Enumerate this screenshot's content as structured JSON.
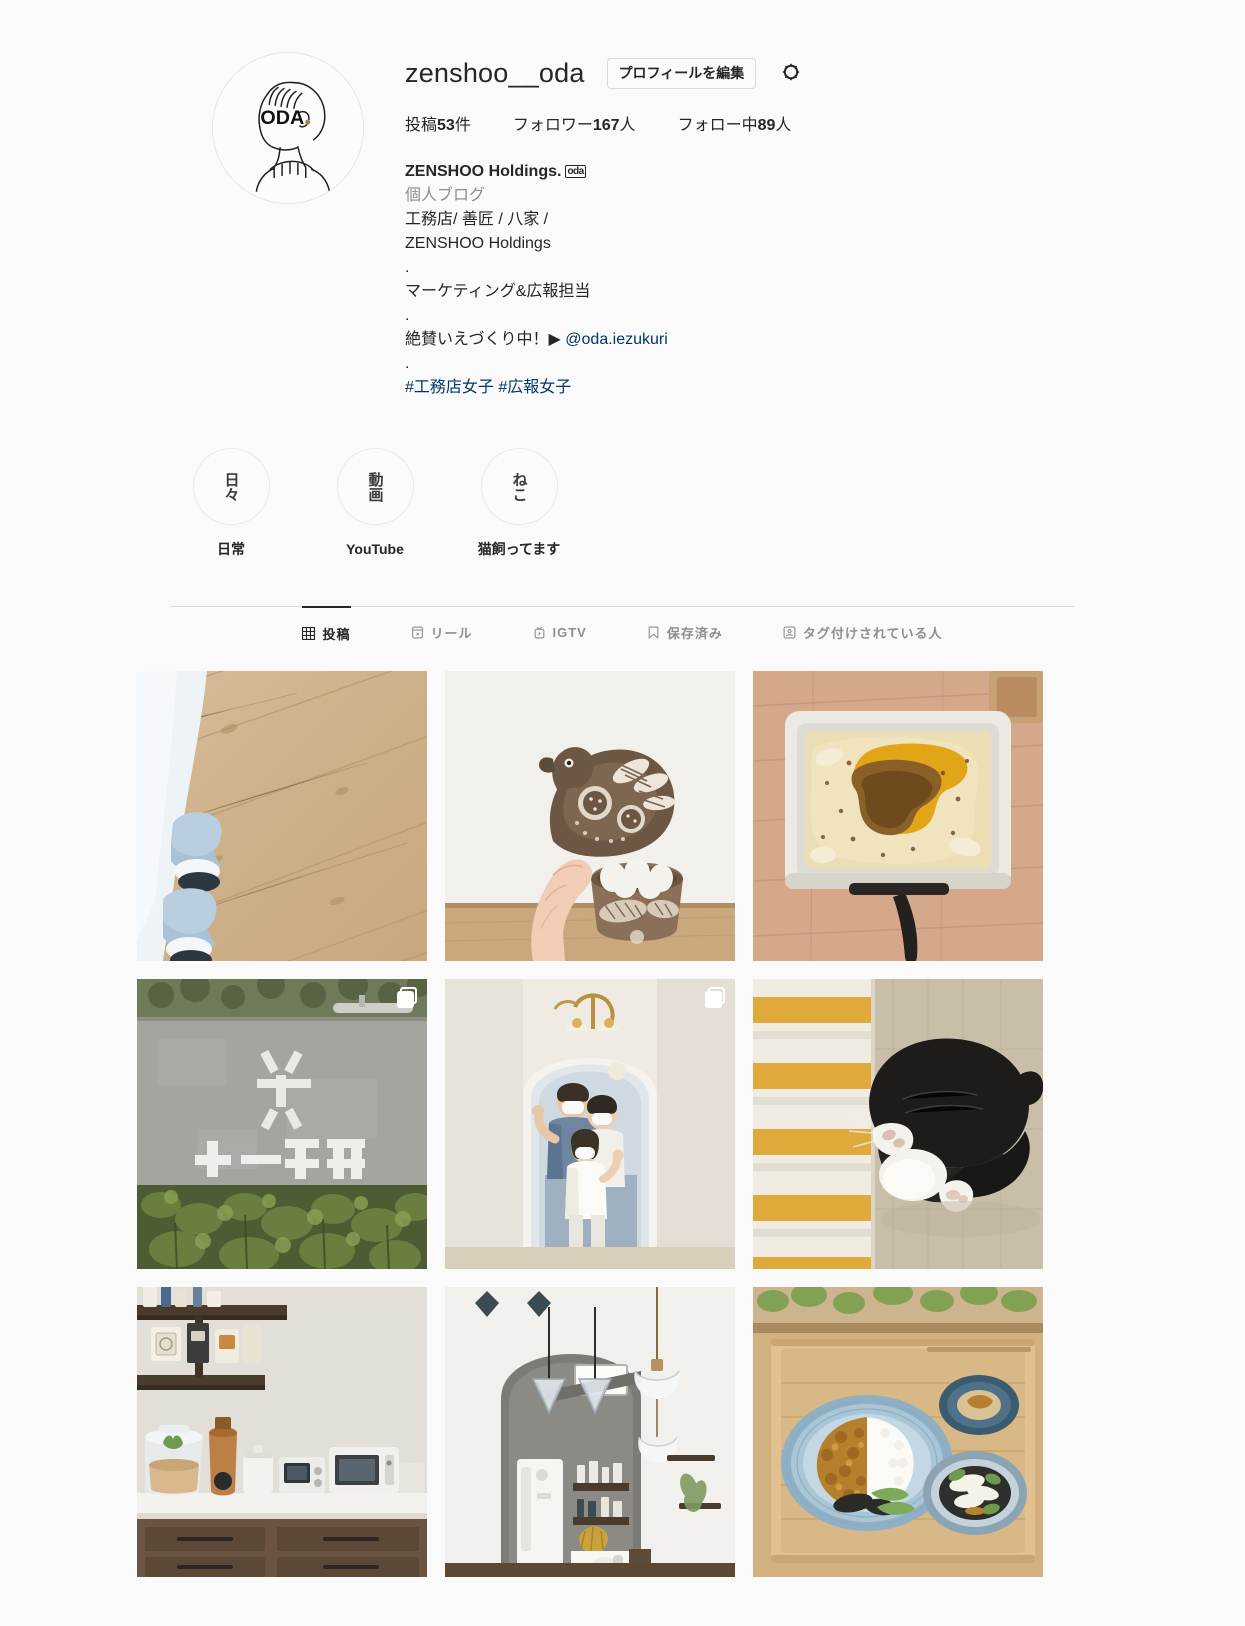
{
  "profile": {
    "username": "zenshoo__oda",
    "edit_button_label": "プロフィールを編集",
    "settings_icon": "gear-icon",
    "avatar_text": "ODA",
    "stats": [
      {
        "label_prefix": "投稿",
        "value": "53",
        "label_suffix": "件"
      },
      {
        "label_prefix": "フォロワー",
        "value": "167",
        "label_suffix": "人"
      },
      {
        "label_prefix": "フォロー中",
        "value": "89",
        "label_suffix": "人"
      }
    ],
    "bio": {
      "display_name": "ZENSHOO Holdings.",
      "verified_badge_text": "oda",
      "category": "個人ブログ",
      "lines": [
        "工務店/ 善匠 / 八家 /",
        "ZENSHOO Holdings",
        ".",
        "マーケティング&広報担当",
        "."
      ],
      "cta_text": "絶賛いえづくり中！▶ ",
      "cta_link": "@oda.iezukuri",
      "spacer_dot": ".",
      "hashtags": "#工務店女子 #広報女子"
    }
  },
  "highlights": [
    {
      "glyph": "日々",
      "label": "日常"
    },
    {
      "glyph": "動画",
      "label": "YouTube"
    },
    {
      "glyph": "ねこ",
      "label": "猫飼ってます"
    }
  ],
  "tabs": [
    {
      "label": "投稿",
      "icon": "grid-icon",
      "active": true
    },
    {
      "label": "リール",
      "icon": "reels-icon",
      "active": false
    },
    {
      "label": "IGTV",
      "icon": "igtv-icon",
      "active": false
    },
    {
      "label": "保存済み",
      "icon": "bookmark-icon",
      "active": false
    },
    {
      "label": "タグ付けされている人",
      "icon": "tagged-person-icon",
      "active": false
    }
  ],
  "grid_posts": [
    {
      "alt": "slippers-on-wood-floor",
      "carousel": false
    },
    {
      "alt": "wooden-bird-and-egg-bowl",
      "carousel": false
    },
    {
      "alt": "baked-gratin-in-white-dish",
      "carousel": false
    },
    {
      "alt": "bee-coffee-concrete-sign",
      "carousel": true
    },
    {
      "alt": "family-portrait-in-arch-hallway",
      "carousel": true
    },
    {
      "alt": "black-and-white-cat-sleeping",
      "carousel": false
    },
    {
      "alt": "kitchen-counter-with-appliances",
      "carousel": false
    },
    {
      "alt": "kitchen-interior-pendant-lights",
      "carousel": false
    },
    {
      "alt": "curry-rice-meal-tray",
      "carousel": false
    }
  ],
  "colors": {
    "page_background": "#fafafa",
    "text_primary": "#262626",
    "text_secondary": "#8e8e8e",
    "link": "#00376b",
    "border": "#dbdbdb"
  }
}
